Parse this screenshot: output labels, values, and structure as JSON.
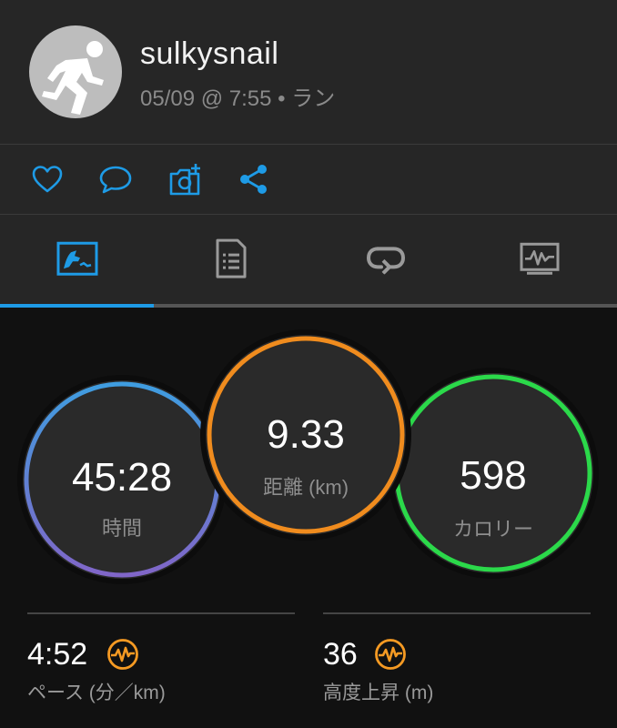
{
  "profile": {
    "username": "sulkysnail",
    "date_time": "05/09 @ 7:55",
    "separator": " • ",
    "activity": "ラン",
    "avatar_icon": "runner-icon"
  },
  "actions": [
    {
      "name": "like",
      "icon": "heart-icon"
    },
    {
      "name": "comment",
      "icon": "comment-icon"
    },
    {
      "name": "photo",
      "icon": "camera-add-icon"
    },
    {
      "name": "share",
      "icon": "share-icon"
    }
  ],
  "tabs": [
    {
      "name": "stats",
      "icon": "activity-stats-icon",
      "active": true
    },
    {
      "name": "details",
      "icon": "document-list-icon",
      "active": false
    },
    {
      "name": "laps",
      "icon": "laps-loop-icon",
      "active": false
    },
    {
      "name": "charts",
      "icon": "chart-monitor-icon",
      "active": false
    }
  ],
  "summary": {
    "time": {
      "value": "45:28",
      "label": "時間"
    },
    "distance": {
      "value": "9.33",
      "label": "距離 (km)"
    },
    "calories": {
      "value": "598",
      "label": "カロリー"
    }
  },
  "metrics": [
    {
      "value": "4:52",
      "label": "ペース (分／km)",
      "icon": "pulse-icon"
    },
    {
      "value": "36",
      "label": "高度上昇 (m)",
      "icon": "pulse-icon"
    }
  ],
  "colors": {
    "accent": "#1e9be6",
    "time_ring_start": "#3f9de0",
    "time_ring_end": "#8066c8",
    "distance_ring": "#f08c1e",
    "calories_ring": "#2bd94a",
    "pulse": "#f59a23"
  }
}
